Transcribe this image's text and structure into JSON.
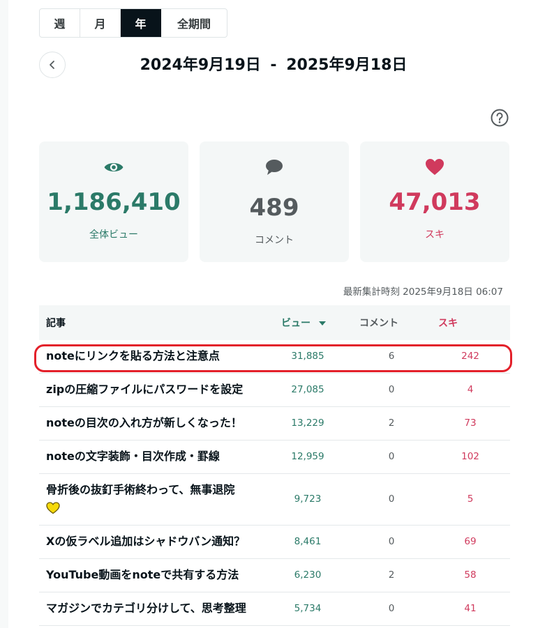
{
  "tabs": [
    {
      "label": "週",
      "active": false
    },
    {
      "label": "月",
      "active": false
    },
    {
      "label": "年",
      "active": true
    },
    {
      "label": "全期間",
      "active": false
    }
  ],
  "period": {
    "start": "2024年9月19日",
    "separator": "-",
    "end": "2025年9月18日"
  },
  "stats": {
    "views": {
      "value": "1,186,410",
      "label": "全体ビュー",
      "icon": "eye-icon",
      "color": "#2b7a68"
    },
    "comments": {
      "value": "489",
      "label": "コメント",
      "icon": "speech-bubble-icon",
      "color": "#555b5e"
    },
    "likes": {
      "value": "47,013",
      "label": "スキ",
      "icon": "heart-icon",
      "color": "#d03a5d"
    }
  },
  "updated_at": "最新集計時刻 2025年9月18日 06:07",
  "table": {
    "headers": {
      "article": "記事",
      "views": "ビュー",
      "comments": "コメント",
      "likes": "スキ"
    },
    "rows": [
      {
        "title": "noteにリンクを貼る方法と注意点",
        "views": "31,885",
        "comments": "6",
        "likes": "242",
        "highlighted": true
      },
      {
        "title": "zipの圧縮ファイルにパスワードを設定",
        "views": "27,085",
        "comments": "0",
        "likes": "4"
      },
      {
        "title": "noteの目次の入れ方が新しくなった！",
        "views": "13,229",
        "comments": "2",
        "likes": "73"
      },
      {
        "title": "noteの文字装飾・目次作成・罫線",
        "views": "12,959",
        "comments": "0",
        "likes": "102"
      },
      {
        "title": "骨折後の抜釘手術終わって、無事退院",
        "emoji": "yellow-heart-icon",
        "views": "9,723",
        "comments": "0",
        "likes": "5"
      },
      {
        "title": "Xの仮ラベル追加はシャドウバン通知？",
        "views": "8,461",
        "comments": "0",
        "likes": "69"
      },
      {
        "title": "YouTube動画をnoteで共有する方法",
        "views": "6,230",
        "comments": "2",
        "likes": "58"
      },
      {
        "title": "マガジンでカテゴリ分けして、思考整理",
        "views": "5,734",
        "comments": "0",
        "likes": "41"
      }
    ]
  },
  "colors": {
    "accent_green": "#2b7a68",
    "accent_red": "#d03a5d",
    "highlight_border": "#e3202a",
    "active_tab": "#08131a"
  }
}
